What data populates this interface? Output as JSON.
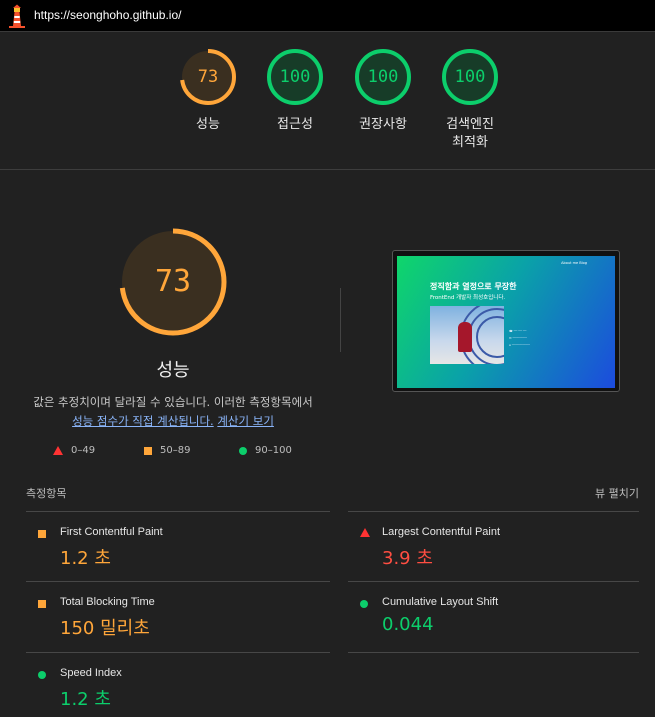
{
  "browser": {
    "url": "https://seonghoho.github.io/",
    "logo_icon": "lighthouse-icon"
  },
  "category_gauges": [
    {
      "score": "73",
      "label": "성능",
      "status": "average"
    },
    {
      "score": "100",
      "label": "접근성",
      "status": "pass"
    },
    {
      "score": "100",
      "label": "권장사항",
      "status": "pass"
    },
    {
      "score": "100",
      "label": "검색엔진 최적화",
      "status": "pass"
    }
  ],
  "colors": {
    "average": "#ffa63a",
    "pass": "#0cce6b",
    "fail": "#ff4e42",
    "background": "#212121"
  },
  "performance": {
    "score": "73",
    "score_value": 0.73,
    "title": "성능",
    "description": "값은 추정치이며 달라질 수 있습니다. 이러한 측정항목에서",
    "link_score": "성능 점수가 직접 계산됩니다.",
    "link_calc": "계산기 보기",
    "legend": [
      {
        "range": "0–49",
        "shape": "triangle-icon"
      },
      {
        "range": "50–89",
        "shape": "square-icon"
      },
      {
        "range": "90–100",
        "shape": "circle-icon"
      }
    ]
  },
  "screenshot": {
    "headline": "정직함과 열정으로 무장한",
    "subline": "FrontEnd 개발자 최성호입니다.",
    "nav": "About me   Blog"
  },
  "metrics_section": {
    "title": "측정항목",
    "expand_label": "뷰 펼치기"
  },
  "metrics": [
    {
      "name": "First Contentful Paint",
      "value": "1.2 초",
      "status": "average"
    },
    {
      "name": "Largest Contentful Paint",
      "value": "3.9 초",
      "status": "fail"
    },
    {
      "name": "Total Blocking Time",
      "value": "150 밀리초",
      "status": "average"
    },
    {
      "name": "Cumulative Layout Shift",
      "value": "0.044",
      "status": "pass"
    },
    {
      "name": "Speed Index",
      "value": "1.2 초",
      "status": "pass"
    }
  ]
}
